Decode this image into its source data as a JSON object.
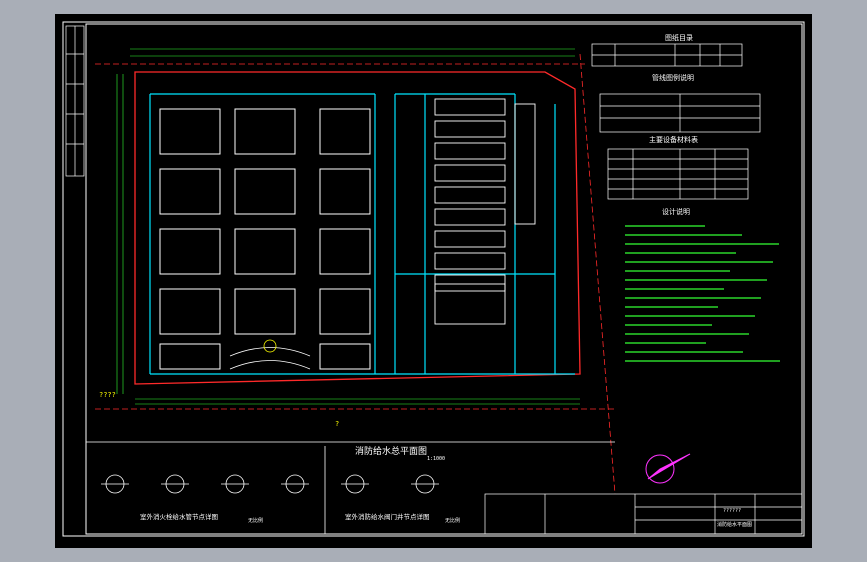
{
  "window": {
    "background": "#a9aeb7",
    "canvas": "#000000"
  },
  "colors": {
    "frame": "#ffffff",
    "boundary": "#ff2a2a",
    "building": "#ffffff",
    "pipe": "#00e5ff",
    "road": "#ffffff",
    "green": "#00ff66",
    "yellow": "#ffff00",
    "magenta": "#ff33ff",
    "dim": "#33ff33"
  },
  "drawing": {
    "plan_title": "消防给水总平面图",
    "plan_scale": "1:1000",
    "legend_title_1": "图纸目录",
    "legend_title_2": "管线图例说明",
    "legend_title_3": "主要设备材料表",
    "notes_title": "设计说明",
    "marks": [
      "?",
      "????",
      "??????"
    ],
    "detail_title_left": "室外消火栓给水管节点详图",
    "detail_title_left_scale": "无比例",
    "detail_title_right": "室外消防给水阀门井节点详图",
    "detail_title_right_scale": "无比例",
    "title_block_name": "消防给水平面图"
  }
}
